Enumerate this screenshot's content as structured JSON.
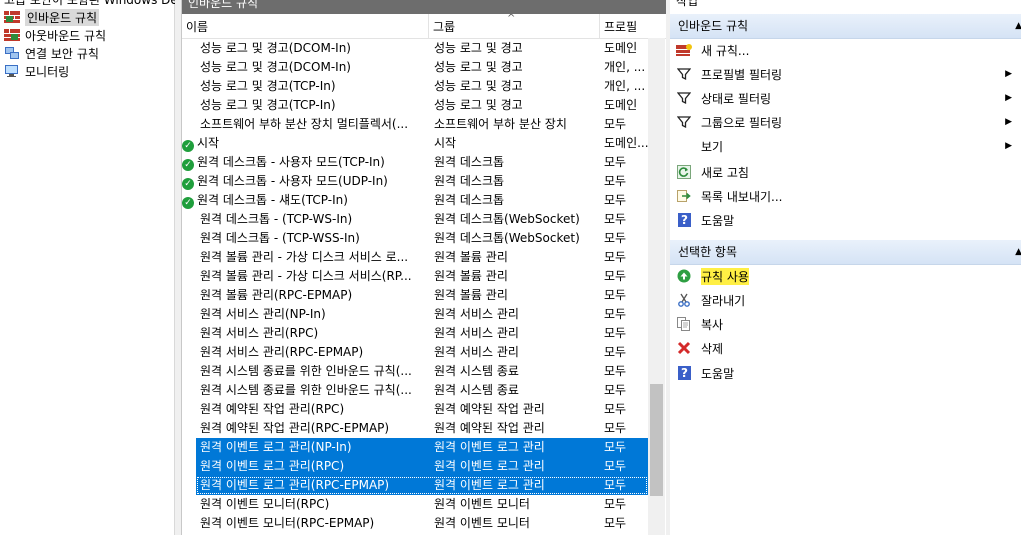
{
  "left_tree": {
    "top_cut_text": "고급 보안이 포함된 Windows Defender 방화벽",
    "items": [
      {
        "label": "인바운드 규칙",
        "icon": "inbound-rules-icon",
        "selected": true
      },
      {
        "label": "아웃바운드 규칙",
        "icon": "outbound-rules-icon",
        "selected": false
      },
      {
        "label": "연결 보안 규칙",
        "icon": "connection-security-icon",
        "selected": false
      },
      {
        "label": "모니터링",
        "icon": "monitoring-icon",
        "selected": false
      }
    ]
  },
  "middle": {
    "title": "인바운드 규칙",
    "columns": [
      "이름",
      "그룹",
      "프로필"
    ],
    "sort_indicator": "^",
    "rows": [
      {
        "enabled": false,
        "name": "성능 로그 및 경고(DCOM-In)",
        "group": "성능 로그 및 경고",
        "profile": "도메인"
      },
      {
        "enabled": false,
        "name": "성능 로그 및 경고(DCOM-In)",
        "group": "성능 로그 및 경고",
        "profile": "개인, ..."
      },
      {
        "enabled": false,
        "name": "성능 로그 및 경고(TCP-In)",
        "group": "성능 로그 및 경고",
        "profile": "개인, ..."
      },
      {
        "enabled": false,
        "name": "성능 로그 및 경고(TCP-In)",
        "group": "성능 로그 및 경고",
        "profile": "도메인"
      },
      {
        "enabled": false,
        "name": "소프트웨어 부하 분산 장치 멀티플렉서(...",
        "group": "소프트웨어 부하 분산 장치",
        "profile": "모두"
      },
      {
        "enabled": true,
        "name": "시작",
        "group": "시작",
        "profile": "도메인..."
      },
      {
        "enabled": true,
        "name": "원격 데스크톱 - 사용자 모드(TCP-In)",
        "group": "원격 데스크톱",
        "profile": "모두"
      },
      {
        "enabled": true,
        "name": "원격 데스크톱 - 사용자 모드(UDP-In)",
        "group": "원격 데스크톱",
        "profile": "모두"
      },
      {
        "enabled": true,
        "name": "원격 데스크톱 - 섀도(TCP-In)",
        "group": "원격 데스크톱",
        "profile": "모두"
      },
      {
        "enabled": false,
        "name": "원격 데스크톱 - (TCP-WS-In)",
        "group": "원격 데스크톱(WebSocket)",
        "profile": "모두"
      },
      {
        "enabled": false,
        "name": "원격 데스크톱 - (TCP-WSS-In)",
        "group": "원격 데스크톱(WebSocket)",
        "profile": "모두"
      },
      {
        "enabled": false,
        "name": "원격 볼륨 관리 - 가상 디스크 서비스 로...",
        "group": "원격 볼륨 관리",
        "profile": "모두"
      },
      {
        "enabled": false,
        "name": "원격 볼륨 관리 - 가상 디스크 서비스(RP...",
        "group": "원격 볼륨 관리",
        "profile": "모두"
      },
      {
        "enabled": false,
        "name": "원격 볼륨 관리(RPC-EPMAP)",
        "group": "원격 볼륨 관리",
        "profile": "모두"
      },
      {
        "enabled": false,
        "name": "원격 서비스 관리(NP-In)",
        "group": "원격 서비스 관리",
        "profile": "모두"
      },
      {
        "enabled": false,
        "name": "원격 서비스 관리(RPC)",
        "group": "원격 서비스 관리",
        "profile": "모두"
      },
      {
        "enabled": false,
        "name": "원격 서비스 관리(RPC-EPMAP)",
        "group": "원격 서비스 관리",
        "profile": "모두"
      },
      {
        "enabled": false,
        "name": "원격 시스템 종료를 위한 인바운드 규칙(...",
        "group": "원격 시스템 종료",
        "profile": "모두"
      },
      {
        "enabled": false,
        "name": "원격 시스템 종료를 위한 인바운드 규칙(...",
        "group": "원격 시스템 종료",
        "profile": "모두"
      },
      {
        "enabled": false,
        "name": "원격 예약된 작업 관리(RPC)",
        "group": "원격 예약된 작업 관리",
        "profile": "모두"
      },
      {
        "enabled": false,
        "name": "원격 예약된 작업 관리(RPC-EPMAP)",
        "group": "원격 예약된 작업 관리",
        "profile": "모두"
      },
      {
        "enabled": false,
        "name": "원격 이벤트 로그 관리(NP-In)",
        "group": "원격 이벤트 로그 관리",
        "profile": "모두",
        "selected": true
      },
      {
        "enabled": false,
        "name": "원격 이벤트 로그 관리(RPC)",
        "group": "원격 이벤트 로그 관리",
        "profile": "모두",
        "selected": true
      },
      {
        "enabled": false,
        "name": "원격 이벤트 로그 관리(RPC-EPMAP)",
        "group": "원격 이벤트 로그 관리",
        "profile": "모두",
        "selected": true,
        "focused": true
      },
      {
        "enabled": false,
        "name": "원격 이벤트 모니터(RPC)",
        "group": "원격 이벤트 모니터",
        "profile": "모두"
      },
      {
        "enabled": false,
        "name": "원격 이벤트 모니터(RPC-EPMAP)",
        "group": "원격 이벤트 모니터",
        "profile": "모두"
      }
    ]
  },
  "right": {
    "title": "작업",
    "section1": {
      "title": "인바운드 규칙",
      "items": [
        {
          "label": "새 규칙...",
          "icon": "new-rule-icon"
        },
        {
          "label": "프로필별 필터링",
          "icon": "filter-icon",
          "submenu": true
        },
        {
          "label": "상태로 필터링",
          "icon": "filter-icon",
          "submenu": true
        },
        {
          "label": "그룹으로 필터링",
          "icon": "filter-icon",
          "submenu": true
        },
        {
          "label": "보기",
          "icon": "",
          "submenu": true
        },
        {
          "label": "새로 고침",
          "icon": "refresh-icon"
        },
        {
          "label": "목록 내보내기...",
          "icon": "export-list-icon"
        },
        {
          "label": "도움말",
          "icon": "help-icon"
        }
      ]
    },
    "section2": {
      "title": "선택한 항목",
      "items": [
        {
          "label": "규칙 사용",
          "icon": "enable-rule-icon",
          "highlight": true
        },
        {
          "label": "잘라내기",
          "icon": "cut-icon"
        },
        {
          "label": "복사",
          "icon": "copy-icon"
        },
        {
          "label": "삭제",
          "icon": "delete-icon"
        },
        {
          "label": "도움말",
          "icon": "help-icon"
        }
      ]
    }
  },
  "colors": {
    "selection": "#0078d7",
    "enabled_check": "#1f9e3c",
    "highlight": "#ffef44"
  }
}
